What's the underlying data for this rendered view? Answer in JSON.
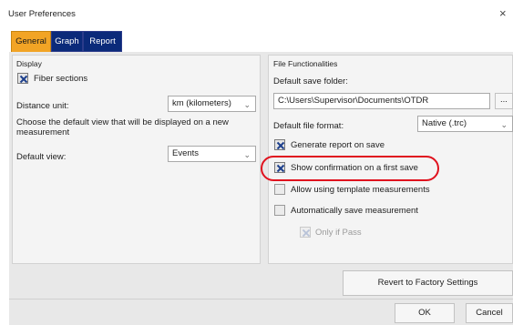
{
  "window": {
    "title": "User Preferences",
    "close_glyph": "×"
  },
  "tabs": [
    {
      "label": "General",
      "active": true
    },
    {
      "label": "Graph",
      "active": false
    },
    {
      "label": "Report",
      "active": false
    }
  ],
  "display": {
    "heading": "Display",
    "fiber_sections": {
      "label": "Fiber sections",
      "checked": true
    },
    "distance_unit": {
      "label": "Distance unit:",
      "value": "km (kilometers)"
    },
    "choose_text": "Choose the default view that will be displayed on a new measurement",
    "default_view": {
      "label": "Default view:",
      "value": "Events"
    }
  },
  "file": {
    "heading": "File Functionalities",
    "save_folder_label": "Default save folder:",
    "save_folder_value": "C:\\Users\\Supervisor\\Documents\\OTDR",
    "browse_label": "...",
    "format_label": "Default file format:",
    "format_value": "Native (.trc)",
    "generate_report": {
      "label": "Generate report on save",
      "checked": true
    },
    "show_confirmation": {
      "label": "Show confirmation on a first save",
      "checked": true
    },
    "allow_template": {
      "label": "Allow using template measurements",
      "checked": false
    },
    "auto_save": {
      "label": "Automatically save measurement",
      "checked": false
    },
    "only_if_pass": {
      "label": "Only if Pass",
      "checked": true,
      "enabled": false
    }
  },
  "buttons": {
    "revert": "Revert to Factory Settings",
    "ok": "OK",
    "cancel": "Cancel"
  },
  "colors": {
    "active_tab": "#f2a425",
    "inactive_tab": "#0b2a7a",
    "highlight": "#e0121e"
  }
}
